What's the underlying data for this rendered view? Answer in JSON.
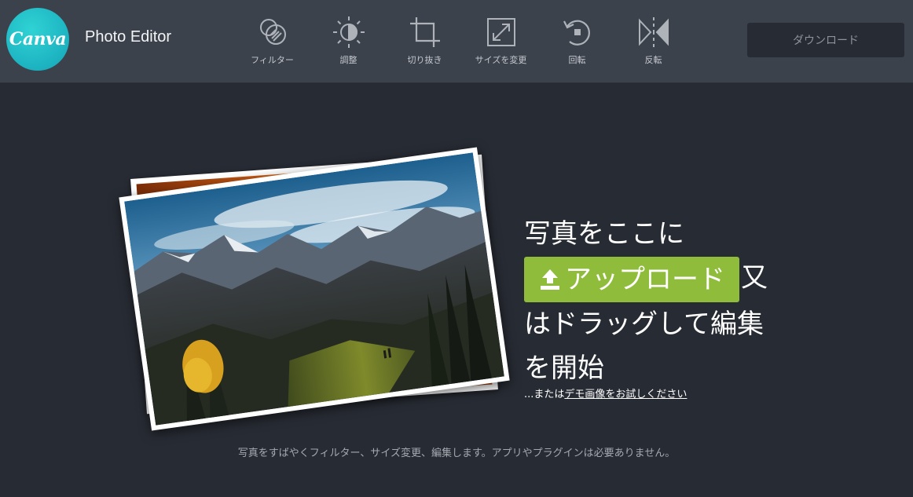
{
  "header": {
    "logo_text": "Canva",
    "app_title": "Photo Editor",
    "download_label": "ダウンロード",
    "tools": [
      {
        "label": "フィルター",
        "icon": "filter-icon"
      },
      {
        "label": "調整",
        "icon": "adjust-icon"
      },
      {
        "label": "切り抜き",
        "icon": "crop-icon"
      },
      {
        "label": "サイズを変更",
        "icon": "resize-icon"
      },
      {
        "label": "回転",
        "icon": "rotate-icon"
      },
      {
        "label": "反転",
        "icon": "flip-icon"
      }
    ]
  },
  "main": {
    "headline_line1": "写真をここに",
    "upload_label": "アップロード",
    "headline_after_upload": "又",
    "headline_line3": "はドラッグして編集",
    "headline_line4": "を開始",
    "demo_prefix": "...または",
    "demo_link": "デモ画像をお試しください",
    "footer": "写真をすばやくフィルター、サイズ変更、編集します。アプリやプラグインは必要ありません。"
  },
  "colors": {
    "header_bg": "#3c424c",
    "page_bg": "#272b33",
    "logo": "#22c1c3",
    "upload_green": "#8fbc3a"
  }
}
